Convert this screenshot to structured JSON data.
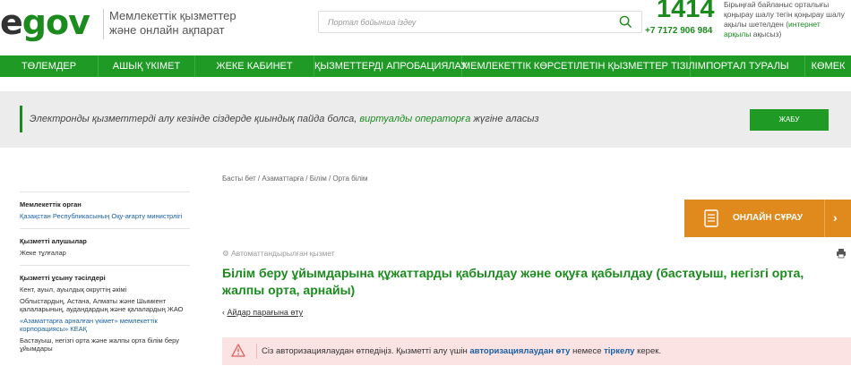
{
  "header": {
    "logo_e": "e",
    "logo_gov": "gov",
    "tagline": "Мемлекеттік қызметтер және онлайн ақпарат",
    "search_placeholder": "Портал бойынша іздеу",
    "hotline_number": "1414",
    "hotline_phone": "+7 7172 906 984",
    "hotline_desc_prefix": "Бірыңғай байланыс орталығы қоңырау шалу тегін қоңырау шалу ақылы шетелден (",
    "hotline_desc_link": "интернет арқылы",
    "hotline_desc_suffix": " ақысыз)"
  },
  "nav": {
    "items": [
      "ТӨЛЕМДЕР",
      "АШЫҚ ҮКІМЕТ",
      "ЖЕКЕ КАБИНЕТ",
      "ҚЫЗМЕТТЕРДІ АПРОБАЦИЯЛАУ",
      "МЕМЛЕКЕТТІК КӨРСЕТІЛЕТІН ҚЫЗМЕТТЕР ТІЗІЛІМІ",
      "ПОРТАЛ ТУРАЛЫ",
      "КӨМЕК"
    ]
  },
  "banner": {
    "text_prefix": "Электронды қызметтерді алу кезінде сіздерде қиындық пайда болса, ",
    "link": "виртуалды операторға",
    "text_suffix": " жүгіне аласыз",
    "close_label": "ЖАБУ"
  },
  "sidebar": {
    "agency_head": "Мемлекеттік орган",
    "agency": "Қазақстан Республикасының Оқу-ағарту министрлігі",
    "recipients_head": "Қызметті алушылар",
    "recipients": "Жеке тұлғалар",
    "providers_head": "Қызметті ұсыну тәсілдері",
    "provider_1": "Кент, ауыл, ауылдық округтің әкімі",
    "provider_2": "Облыстардың, Астана, Алматы және Шымкент қалаларының, аудандардың және қалалардың ЖАО",
    "provider_3": "«Азаматтарға арналған үкімет» мемлекеттік корпорациясы» КЕАҚ",
    "provider_4": "Бастауыш, негізгі орта және жалпы орта білім беру ұйымдары"
  },
  "main": {
    "breadcrumb": "Басты бет / Азаматтарға / Білім / Орта білім",
    "online_button": "ОНЛАЙН СҰРАУ",
    "auto_label": "Автоматтандырылған қызмет",
    "title": "Білім беру ұйымдарына құжаттарды қабылдау және оқуға қабылдау (бастауыш, негізгі орта, жалпы орта, арнайы)",
    "back_link": "Айдар парағына өту",
    "alert_prefix": "Сіз авторизациялаудан өтпедіңіз. Қызметті алу үшін ",
    "alert_link1": "авторизациялаудан өту",
    "alert_mid": " немесе ",
    "alert_link2": "тіркелу",
    "alert_suffix": " керек."
  },
  "colors": {
    "brand_green": "#1f9a25",
    "accent_orange": "#e08a1e",
    "alert_bg": "#fbe3e3",
    "link_blue": "#1a5fa6"
  },
  "icons": [
    "search-icon",
    "document-icon",
    "chevron-right-icon",
    "gear-icon",
    "print-icon",
    "warning-icon",
    "chevron-left-icon"
  ]
}
